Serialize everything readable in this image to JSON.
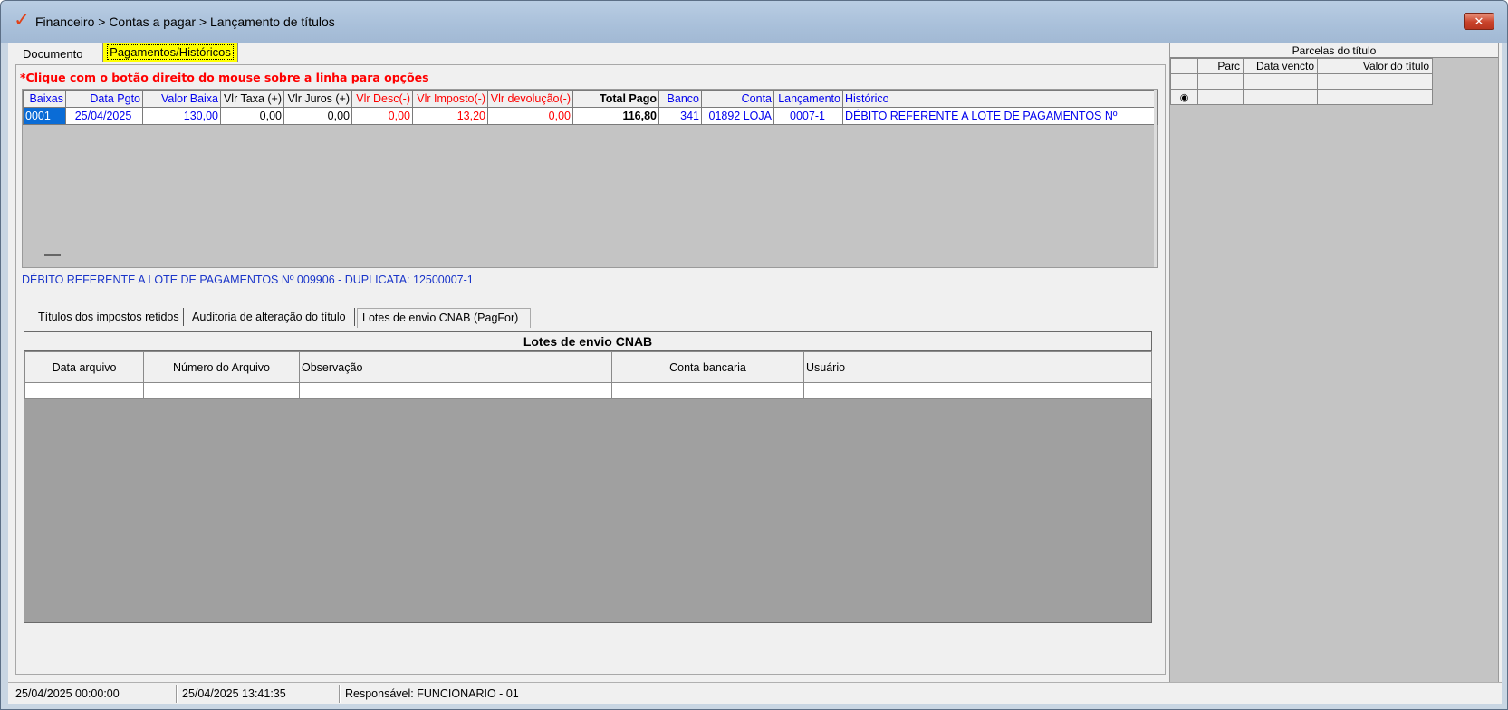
{
  "window": {
    "title": "Financeiro > Contas a pagar > Lançamento de títulos",
    "close_glyph": "✕",
    "logo_glyph": "✓"
  },
  "tabs": {
    "documento": "Documento",
    "pagamentos": "Pagamentos/Históricos"
  },
  "hint": "*Clique com o botão direito do mouse sobre a linha para opções",
  "payments": {
    "headers": [
      "Baixas",
      "Data Pgto",
      "Valor Baixa",
      "Vlr Taxa (+)",
      "Vlr Juros (+)",
      "Vlr Desc(-)",
      "Vlr Imposto(-)",
      "Vlr devolução(-)",
      "Total Pago",
      "Banco",
      "Conta",
      "Lançamento",
      "Histórico"
    ],
    "rows": [
      [
        "0001",
        "25/04/2025",
        "130,00",
        "0,00",
        "0,00",
        "0,00",
        "13,20",
        "0,00",
        "116,80",
        "341",
        "01892 LOJA",
        "0007-1",
        "DÉBITO REFERENTE A LOTE DE PAGAMENTOS Nº"
      ]
    ]
  },
  "historico_full": "DÉBITO REFERENTE A LOTE DE PAGAMENTOS Nº 009906 - DUPLICATA: 12500007-1",
  "sub_tabs": [
    "Títulos dos impostos retidos",
    "Auditoria de alteração do título",
    "Lotes de envio CNAB (PagFor)"
  ],
  "cnab": {
    "title": "Lotes de envio CNAB",
    "headers": [
      "Data arquivo",
      "Número do Arquivo",
      "Observação",
      "Conta bancaria",
      "Usuário"
    ]
  },
  "parcelas": {
    "title": "Parcelas do título",
    "headers": [
      "",
      "Parc",
      "Data vencto",
      "Valor do título"
    ],
    "row_marker": "◉"
  },
  "status": {
    "created": "25/04/2025 00:00:00",
    "updated": "25/04/2025 13:41:35",
    "responsavel": "Responsável: FUNCIONARIO - 01"
  },
  "colors": {
    "selection": "#0a6cd6",
    "tab_active": "#ffff00",
    "hint": "#ff0000",
    "link_blue": "#0000ee"
  }
}
